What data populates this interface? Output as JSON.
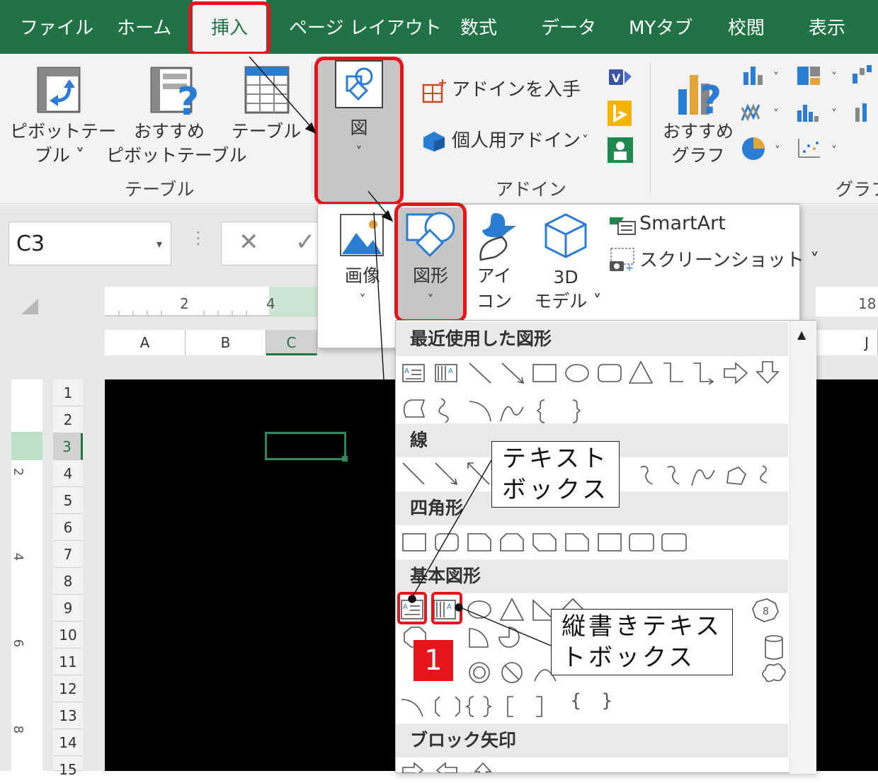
{
  "tabs": [
    {
      "label": "ファイル"
    },
    {
      "label": "ホーム"
    },
    {
      "label": "挿入"
    },
    {
      "label": "ページ レイアウト"
    },
    {
      "label": "数式"
    },
    {
      "label": "データ"
    },
    {
      "label": "MYタブ"
    },
    {
      "label": "校閲"
    },
    {
      "label": "表示"
    }
  ],
  "ribbon": {
    "pivot_l1": "ピボットテー",
    "pivot_l2": "ブル ˅",
    "rec_pivot_l1": "おすすめ",
    "rec_pivot_l2": "ピボットテーブル",
    "table": "テーブル",
    "group_table": "テーブル",
    "illustrations": "図",
    "illustrations_caret": "˅",
    "get_addins": "アドインを入手",
    "my_addins": "個人用アドイン",
    "my_addins_caret": "˅",
    "group_addins": "アドイン",
    "rec_chart_l1": "おすすめ",
    "rec_chart_l2": "グラフ",
    "group_chart": "グラフ"
  },
  "formula": {
    "namebox": "C3",
    "cancel": "✕",
    "enter": "✓"
  },
  "ruler": {
    "h": [
      "2",
      "4",
      "18"
    ],
    "v": [
      "2",
      "4",
      "6",
      "8"
    ]
  },
  "columns": [
    "A",
    "B",
    "C",
    "J"
  ],
  "rows": [
    "1",
    "2",
    "3",
    "4",
    "5",
    "6",
    "7",
    "8",
    "9",
    "10",
    "11",
    "12",
    "13",
    "14",
    "15"
  ],
  "picmenu": {
    "image": "画像",
    "shapes": "図形",
    "icon_l1": "アイ",
    "icon_l2": "コン",
    "model_l1": "3D",
    "model_l2": "モデル ˅",
    "caret": "˅",
    "smartart": "SmartArt",
    "screenshot": "スクリーンショット ˅"
  },
  "shapes_panel": {
    "recent": "最近使用した図形",
    "lines": "線",
    "rect": "四角形",
    "basic": "基本図形",
    "block": "ブロック矢印",
    "octagon_label": "8"
  },
  "callouts": {
    "textbox_l1": "テキスト",
    "textbox_l2": "ボックス",
    "vtextbox_l1": "縦書きテキス",
    "vtextbox_l2": "トボックス"
  },
  "badge": "1",
  "colors": {
    "excel_green": "#217346",
    "highlight_red": "#e8141b"
  }
}
